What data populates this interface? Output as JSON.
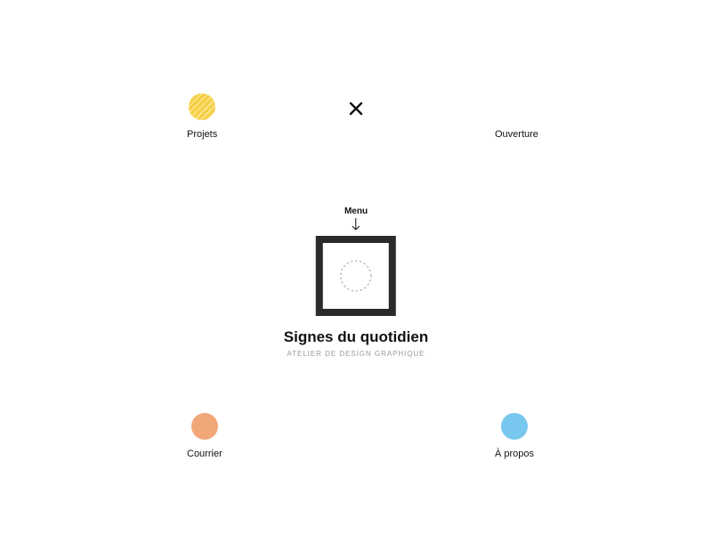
{
  "nav": {
    "projets": {
      "label": "Projets",
      "color": "#f6d043"
    },
    "ouverture": {
      "label": "Ouverture",
      "color": "#6fe098"
    },
    "courrier": {
      "label": "Courrier",
      "color": "#f2a779"
    },
    "apropos": {
      "label": "À propos",
      "color": "#78c7ef"
    }
  },
  "center": {
    "menu_label": "Menu",
    "title": "Signes du quotidien",
    "subtitle": "ATELIER DE DESIGN GRAPHIQUE"
  }
}
